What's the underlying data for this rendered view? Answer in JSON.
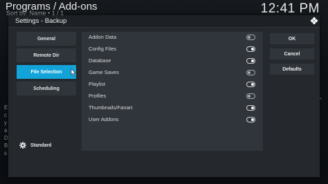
{
  "header": {
    "title": "Programs / Add-ons",
    "sort_text": "Sort by: Name  •  1 / 1",
    "clock": "12:41 PM"
  },
  "background_glyphs": [
    "E",
    "c",
    "y",
    "a",
    "D",
    "B",
    "s"
  ],
  "dialog": {
    "title": "Settings - Backup",
    "categories": [
      {
        "label": "General",
        "active": false
      },
      {
        "label": "Remote Dir",
        "active": false
      },
      {
        "label": "File Selection",
        "active": true
      },
      {
        "label": "Scheduling",
        "active": false
      }
    ],
    "level_label": "Standard",
    "settings": [
      {
        "label": "Addon Data",
        "enabled": false
      },
      {
        "label": "Config Files",
        "enabled": true
      },
      {
        "label": "Database",
        "enabled": true
      },
      {
        "label": "Game Saves",
        "enabled": false
      },
      {
        "label": "Playlist",
        "enabled": true
      },
      {
        "label": "Profiles",
        "enabled": false
      },
      {
        "label": "Thumbnails/Fanart",
        "enabled": true
      },
      {
        "label": "User Addons",
        "enabled": true
      }
    ],
    "buttons": {
      "ok": "OK",
      "cancel": "Cancel",
      "defaults": "Defaults"
    }
  },
  "colors": {
    "accent": "#12a3d9",
    "panel": "#30353b",
    "dialog": "#25292e"
  },
  "icons": {
    "logo": "kodi-logo-icon",
    "level": "gear-icon",
    "pointer": "mouse-pointer-icon"
  }
}
